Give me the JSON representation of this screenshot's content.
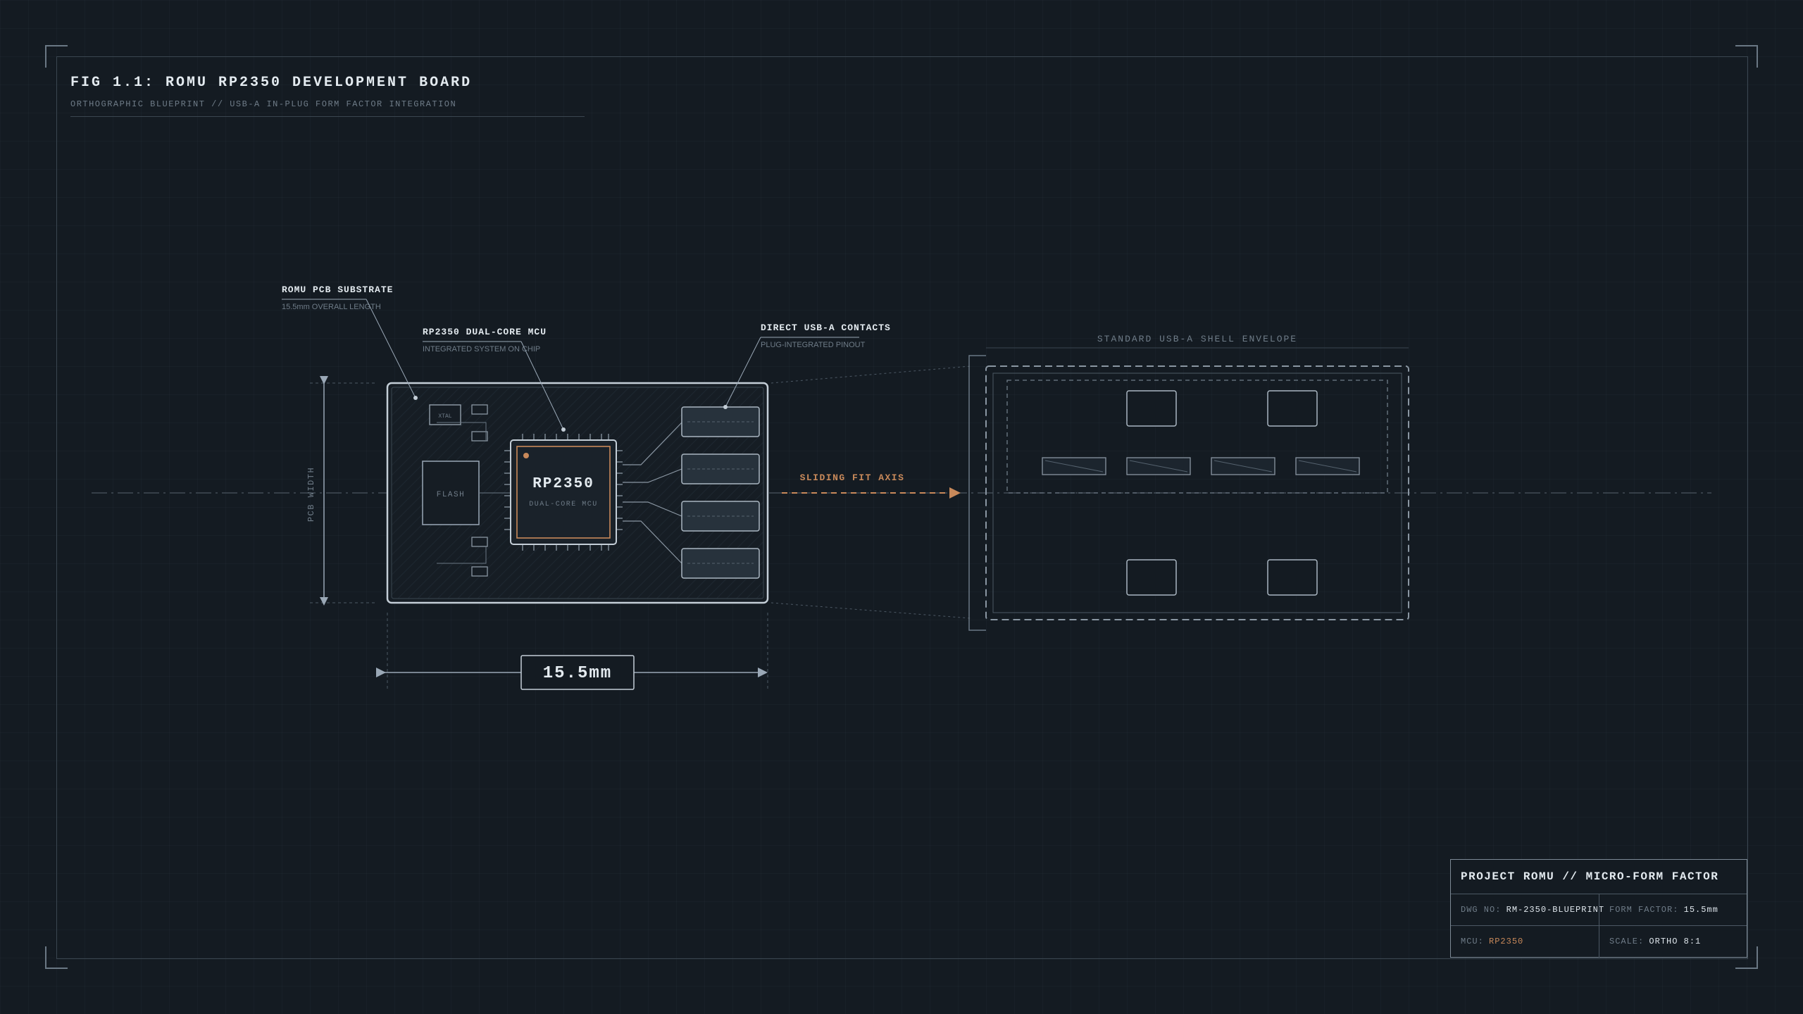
{
  "figure": {
    "title": "FIG 1.1: ROMU RP2350 DEVELOPMENT BOARD",
    "subtitle": "ORTHOGRAPHIC BLUEPRINT // USB-A IN-PLUG FORM FACTOR INTEGRATION"
  },
  "callouts": {
    "pcb": {
      "title": "ROMU PCB SUBSTRATE",
      "subtitle": "15.5mm OVERALL LENGTH"
    },
    "mcu": {
      "title": "RP2350 DUAL-CORE MCU",
      "subtitle": "INTEGRATED SYSTEM ON CHIP"
    },
    "contacts": {
      "title": "DIRECT USB-A CONTACTS",
      "subtitle": "PLUG-INTEGRATED PINOUT"
    }
  },
  "board": {
    "xtal_label": "XTAL",
    "flash_label": "FLASH",
    "chip_name": "RP2350",
    "chip_desc": "DUAL-CORE MCU",
    "width_label": "PCB WIDTH",
    "length_value": "15.5mm"
  },
  "axis": {
    "label": "SLIDING FIT AXIS"
  },
  "shell": {
    "label": "STANDARD USB-A SHELL ENVELOPE"
  },
  "title_block": {
    "heading": "PROJECT ROMU // MICRO-FORM FACTOR",
    "dwg_key": "DWG NO:",
    "dwg_value": "RM-2350-BLUEPRINT",
    "form_key": "FORM FACTOR:",
    "form_value": "15.5mm",
    "mcu_key": "MCU:",
    "mcu_value": "RP2350",
    "scale_key": "SCALE:",
    "scale_value": "ORTHO 8:1"
  },
  "colors": {
    "background": "#141b22",
    "line": "#9aa8b6",
    "accent": "#c8895a"
  }
}
